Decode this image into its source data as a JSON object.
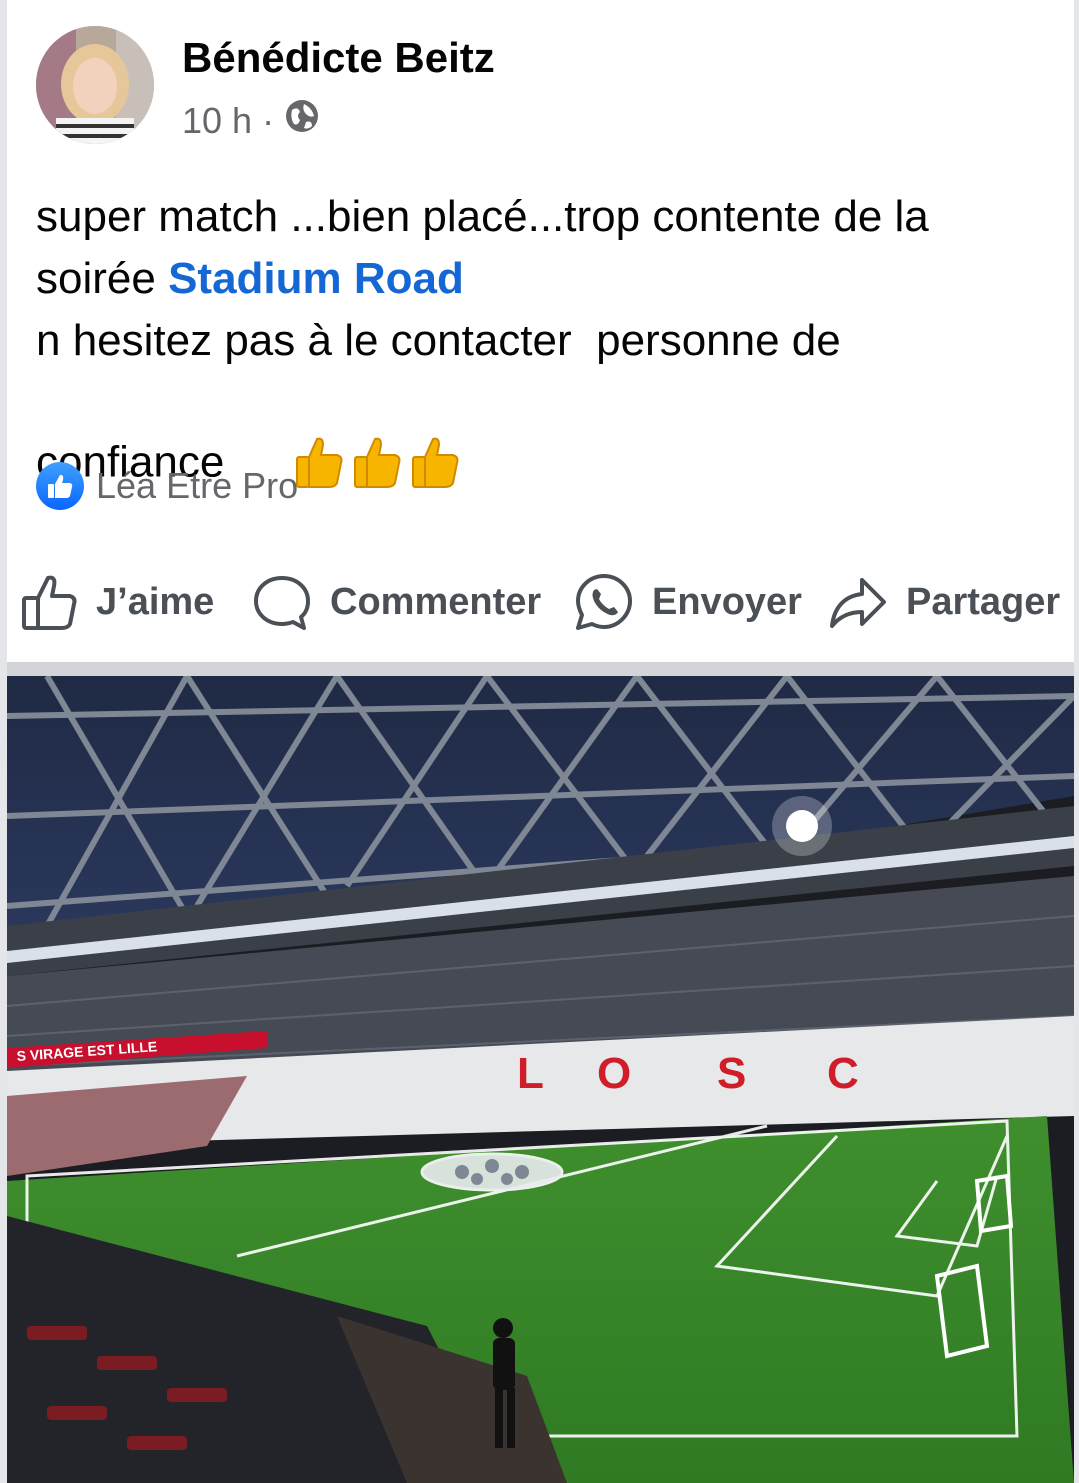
{
  "post": {
    "author": "Bénédicte Beitz",
    "time": "10 h",
    "separator": "·",
    "audience_icon": "globe-icon",
    "text_lines": [
      "super match ...bien placé...trop contente de la",
      "soirée ",
      "n hesitez pas à le contacter  personne de",
      "confiance "
    ],
    "mention": "Stadium Road",
    "emoji": "thumbs-up-icon"
  },
  "reactions": {
    "icon": "like-icon",
    "names": "Léa Etre Pro"
  },
  "actions": {
    "like": "J’aime",
    "comment": "Commenter",
    "send": "Envoyer",
    "share": "Partager"
  },
  "photo": {
    "banner_text": "S VIRAGE EST LILLE",
    "stand_letters": [
      "L",
      "O",
      "S",
      "C"
    ]
  }
}
